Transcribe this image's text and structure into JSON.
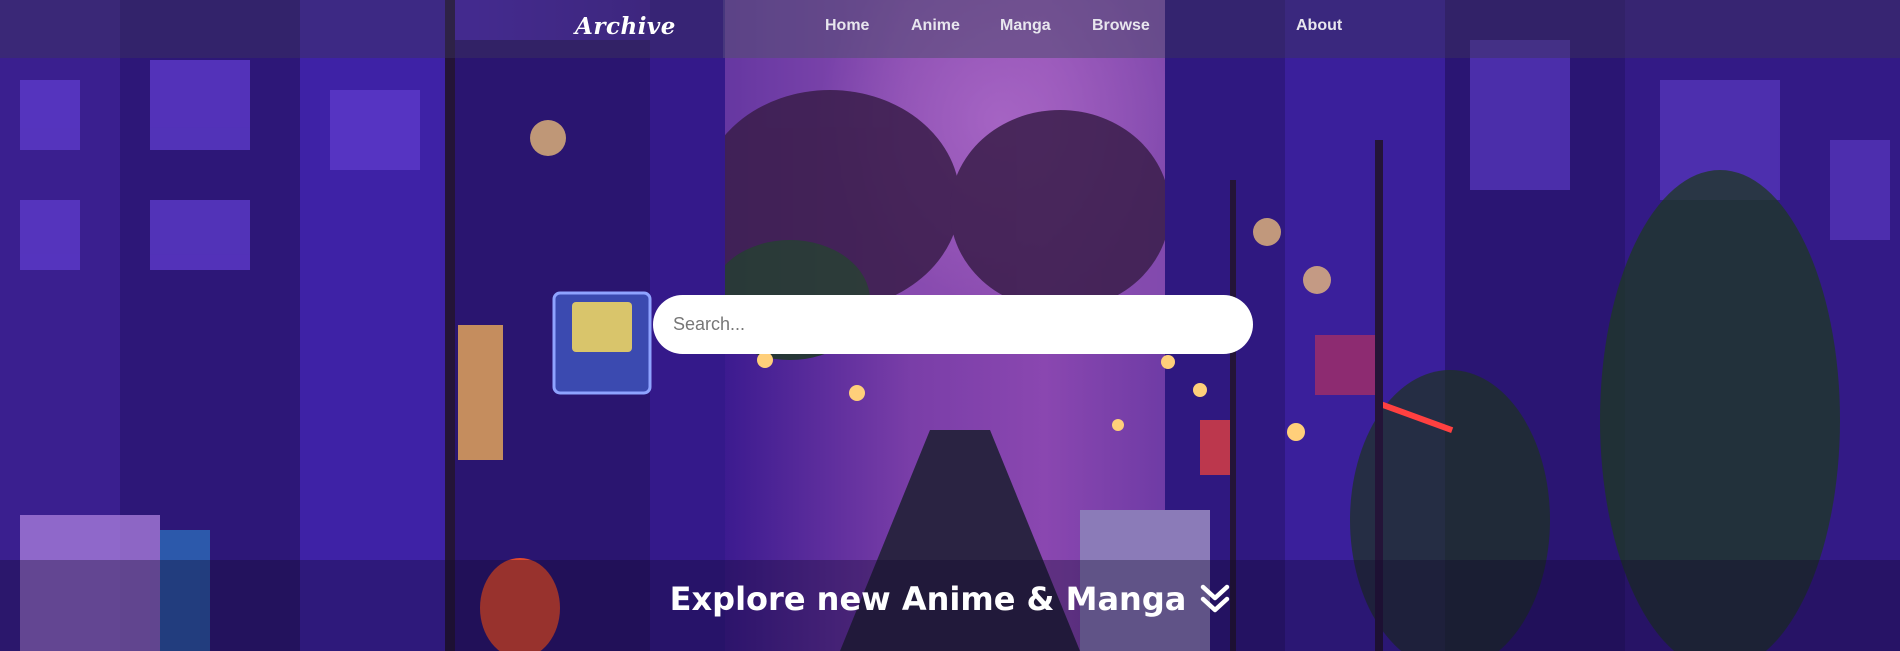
{
  "navbar": {
    "brand": "Archive",
    "links": [
      {
        "label": "Home"
      },
      {
        "label": "Anime"
      },
      {
        "label": "Manga"
      },
      {
        "label": "Browse"
      },
      {
        "label": "About"
      }
    ]
  },
  "search": {
    "placeholder": "Search...",
    "value": ""
  },
  "hero": {
    "cta_text": "Explore new Anime & Manga",
    "cta_icon": "double-chevron-down-icon",
    "background_image": "neon-city-street-icon"
  },
  "colors": {
    "nav_bg": "#3c325a",
    "text": "#ffffff",
    "accent_purple": "#4a24b8",
    "search_bg": "#ffffff"
  }
}
